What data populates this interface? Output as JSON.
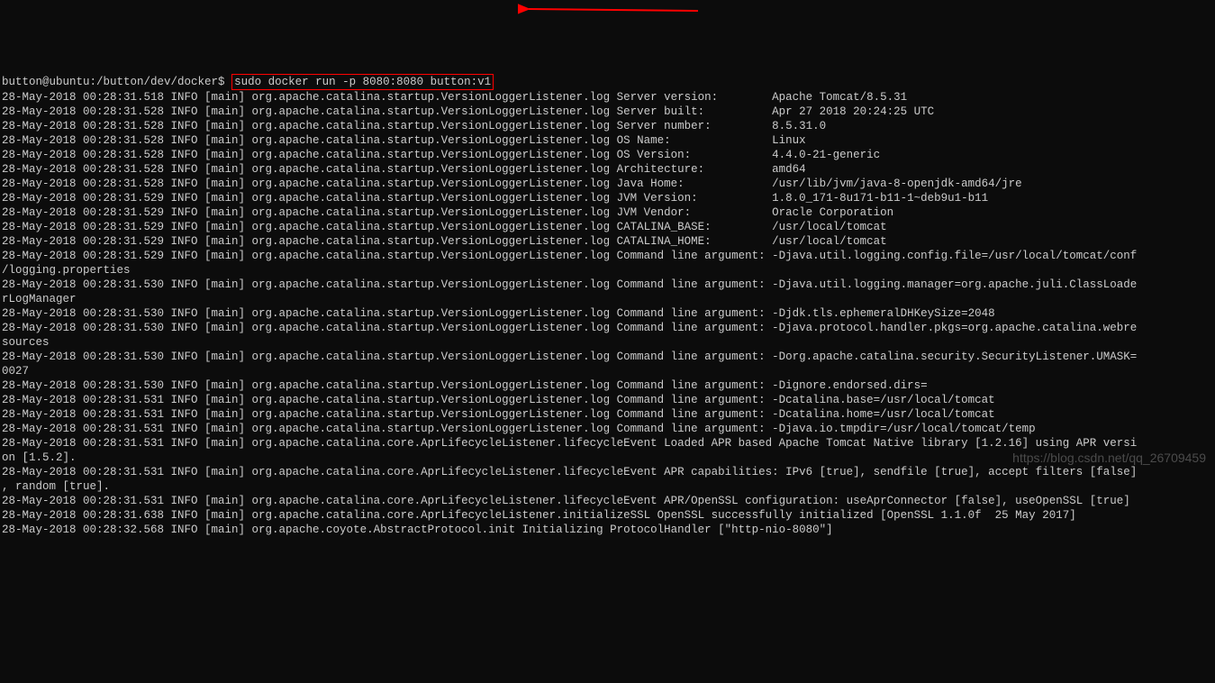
{
  "prompt": "button@ubuntu:/button/dev/docker$",
  "command": "sudo docker run -p 8080:8080 button:v1",
  "watermark": "https://blog.csdn.net/qq_26709459",
  "lines": [
    "28-May-2018 00:28:31.518 INFO [main] org.apache.catalina.startup.VersionLoggerListener.log Server version:        Apache Tomcat/8.5.31",
    "28-May-2018 00:28:31.528 INFO [main] org.apache.catalina.startup.VersionLoggerListener.log Server built:          Apr 27 2018 20:24:25 UTC",
    "28-May-2018 00:28:31.528 INFO [main] org.apache.catalina.startup.VersionLoggerListener.log Server number:         8.5.31.0",
    "28-May-2018 00:28:31.528 INFO [main] org.apache.catalina.startup.VersionLoggerListener.log OS Name:               Linux",
    "28-May-2018 00:28:31.528 INFO [main] org.apache.catalina.startup.VersionLoggerListener.log OS Version:            4.4.0-21-generic",
    "28-May-2018 00:28:31.528 INFO [main] org.apache.catalina.startup.VersionLoggerListener.log Architecture:          amd64",
    "28-May-2018 00:28:31.528 INFO [main] org.apache.catalina.startup.VersionLoggerListener.log Java Home:             /usr/lib/jvm/java-8-openjdk-amd64/jre",
    "28-May-2018 00:28:31.529 INFO [main] org.apache.catalina.startup.VersionLoggerListener.log JVM Version:           1.8.0_171-8u171-b11-1~deb9u1-b11",
    "28-May-2018 00:28:31.529 INFO [main] org.apache.catalina.startup.VersionLoggerListener.log JVM Vendor:            Oracle Corporation",
    "28-May-2018 00:28:31.529 INFO [main] org.apache.catalina.startup.VersionLoggerListener.log CATALINA_BASE:         /usr/local/tomcat",
    "28-May-2018 00:28:31.529 INFO [main] org.apache.catalina.startup.VersionLoggerListener.log CATALINA_HOME:         /usr/local/tomcat",
    "28-May-2018 00:28:31.529 INFO [main] org.apache.catalina.startup.VersionLoggerListener.log Command line argument: -Djava.util.logging.config.file=/usr/local/tomcat/conf",
    "/logging.properties",
    "28-May-2018 00:28:31.530 INFO [main] org.apache.catalina.startup.VersionLoggerListener.log Command line argument: -Djava.util.logging.manager=org.apache.juli.ClassLoade",
    "rLogManager",
    "28-May-2018 00:28:31.530 INFO [main] org.apache.catalina.startup.VersionLoggerListener.log Command line argument: -Djdk.tls.ephemeralDHKeySize=2048",
    "28-May-2018 00:28:31.530 INFO [main] org.apache.catalina.startup.VersionLoggerListener.log Command line argument: -Djava.protocol.handler.pkgs=org.apache.catalina.webre",
    "sources",
    "28-May-2018 00:28:31.530 INFO [main] org.apache.catalina.startup.VersionLoggerListener.log Command line argument: -Dorg.apache.catalina.security.SecurityListener.UMASK=",
    "0027",
    "28-May-2018 00:28:31.530 INFO [main] org.apache.catalina.startup.VersionLoggerListener.log Command line argument: -Dignore.endorsed.dirs=",
    "28-May-2018 00:28:31.531 INFO [main] org.apache.catalina.startup.VersionLoggerListener.log Command line argument: -Dcatalina.base=/usr/local/tomcat",
    "28-May-2018 00:28:31.531 INFO [main] org.apache.catalina.startup.VersionLoggerListener.log Command line argument: -Dcatalina.home=/usr/local/tomcat",
    "28-May-2018 00:28:31.531 INFO [main] org.apache.catalina.startup.VersionLoggerListener.log Command line argument: -Djava.io.tmpdir=/usr/local/tomcat/temp",
    "28-May-2018 00:28:31.531 INFO [main] org.apache.catalina.core.AprLifecycleListener.lifecycleEvent Loaded APR based Apache Tomcat Native library [1.2.16] using APR versi",
    "on [1.5.2].",
    "28-May-2018 00:28:31.531 INFO [main] org.apache.catalina.core.AprLifecycleListener.lifecycleEvent APR capabilities: IPv6 [true], sendfile [true], accept filters [false]",
    ", random [true].",
    "28-May-2018 00:28:31.531 INFO [main] org.apache.catalina.core.AprLifecycleListener.lifecycleEvent APR/OpenSSL configuration: useAprConnector [false], useOpenSSL [true]",
    "28-May-2018 00:28:31.638 INFO [main] org.apache.catalina.core.AprLifecycleListener.initializeSSL OpenSSL successfully initialized [OpenSSL 1.1.0f  25 May 2017]",
    "28-May-2018 00:28:32.568 INFO [main] org.apache.coyote.AbstractProtocol.init Initializing ProtocolHandler [\"http-nio-8080\"]"
  ]
}
